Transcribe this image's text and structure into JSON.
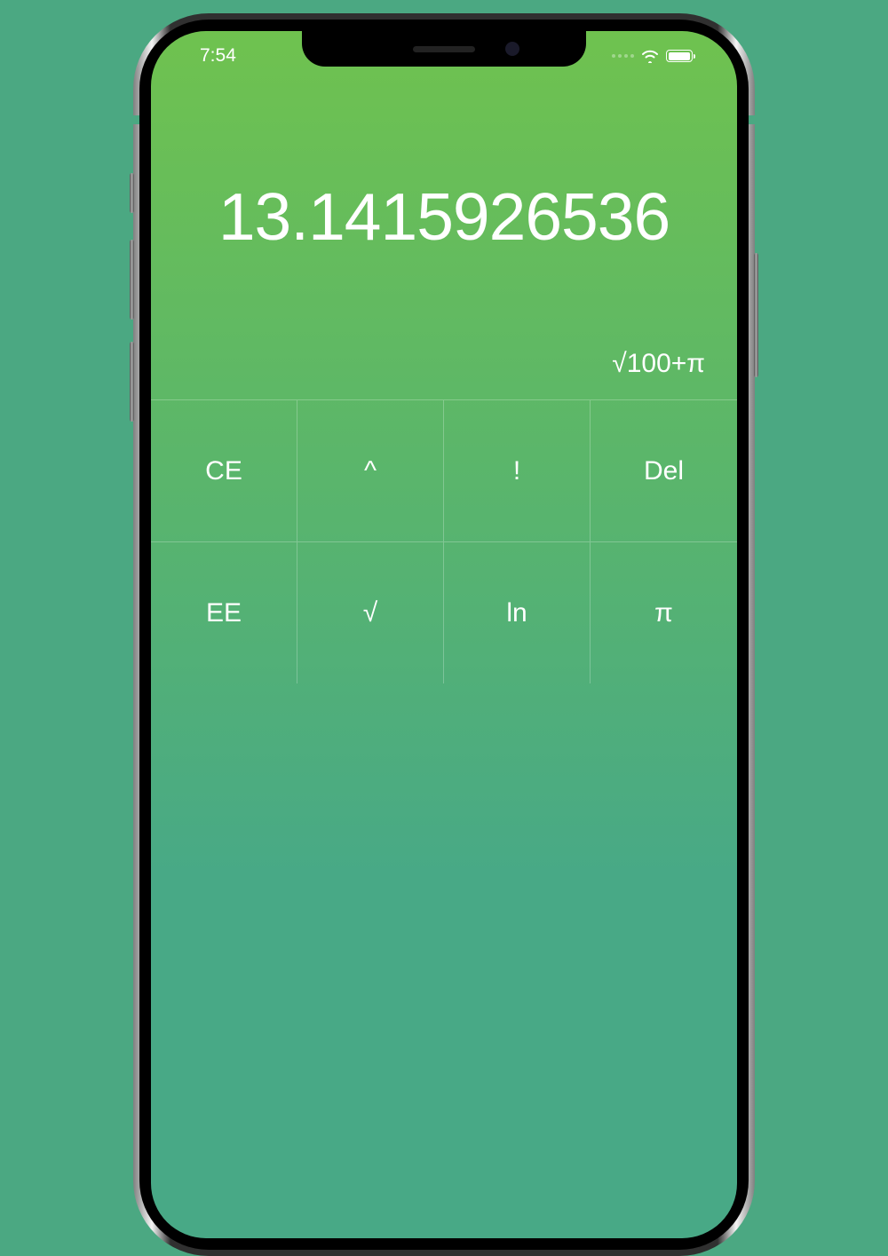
{
  "status": {
    "time": "7:54"
  },
  "calculator": {
    "result": "13.1415926536",
    "expression": "√100+π",
    "rows": [
      {
        "k1": "CE",
        "k2": "^",
        "k3": "!",
        "k4": "Del"
      },
      {
        "k1": "EE",
        "k2": "√",
        "k3": "ln",
        "k4": "π"
      }
    ]
  }
}
